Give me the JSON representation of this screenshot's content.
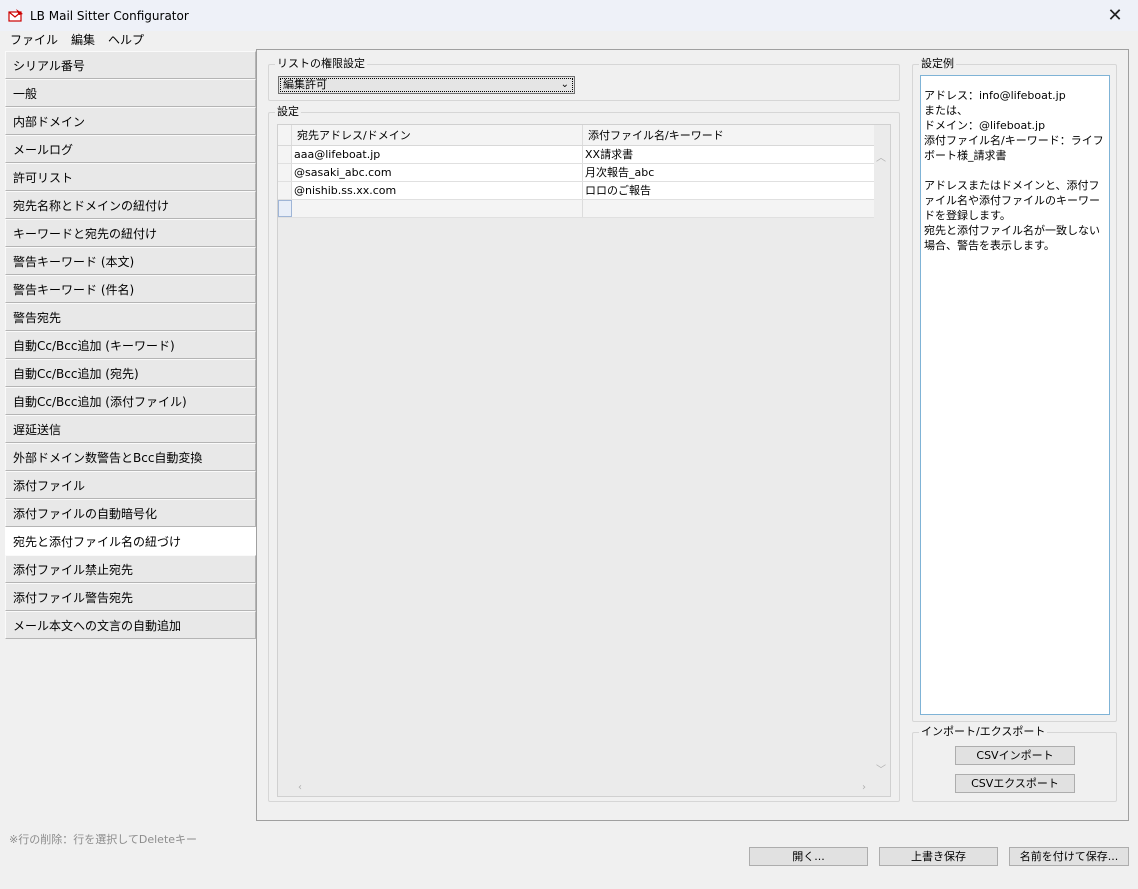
{
  "window": {
    "title": "LB Mail Sitter Configurator"
  },
  "menu": [
    "ファイル",
    "編集",
    "ヘルプ"
  ],
  "sidebar": {
    "items": [
      "シリアル番号",
      "一般",
      "内部ドメイン",
      "メールログ",
      "許可リスト",
      "宛先名称とドメインの紐付け",
      "キーワードと宛先の紐付け",
      "警告キーワード (本文)",
      "警告キーワード (件名)",
      "警告宛先",
      "自動Cc/Bcc追加 (キーワード)",
      "自動Cc/Bcc追加 (宛先)",
      "自動Cc/Bcc追加 (添付ファイル)",
      "遅延送信",
      "外部ドメイン数警告とBcc自動変換",
      "添付ファイル",
      "添付ファイルの自動暗号化",
      "宛先と添付ファイル名の紐づけ",
      "添付ファイル禁止宛先",
      "添付ファイル警告宛先",
      "メール本文への文言の自動追加"
    ],
    "active_index": 17
  },
  "permission": {
    "group_title": "リストの権限設定",
    "selected": "編集許可"
  },
  "settings": {
    "group_title": "設定",
    "columns": [
      "宛先アドレス/ドメイン",
      "添付ファイル名/キーワード"
    ],
    "rows": [
      [
        "aaa@lifeboat.jp",
        "XX請求書"
      ],
      [
        "@sasaki_abc.com",
        "月次報告_abc"
      ],
      [
        "@nishib.ss.xx.com",
        "ロロのご報告"
      ]
    ]
  },
  "example": {
    "group_title": "設定例",
    "text": "アドレス：info@lifeboat.jp\nまたは、\nドメイン：@lifeboat.jp\n添付ファイル名/キーワード：ライフボート様_請求書\n\nアドレスまたはドメインと、添付ファイル名や添付ファイルのキーワードを登録します。\n宛先と添付ファイル名が一致しない場合、警告を表示します。"
  },
  "import_export": {
    "group_title": "インポート/エクスポート",
    "csv_import": "CSVインポート",
    "csv_export": "CSVエクスポート"
  },
  "footer": {
    "hint": "※行の削除：行を選択してDeleteキー",
    "open": "開く...",
    "overwrite_save": "上書き保存",
    "save_as": "名前を付けて保存..."
  }
}
